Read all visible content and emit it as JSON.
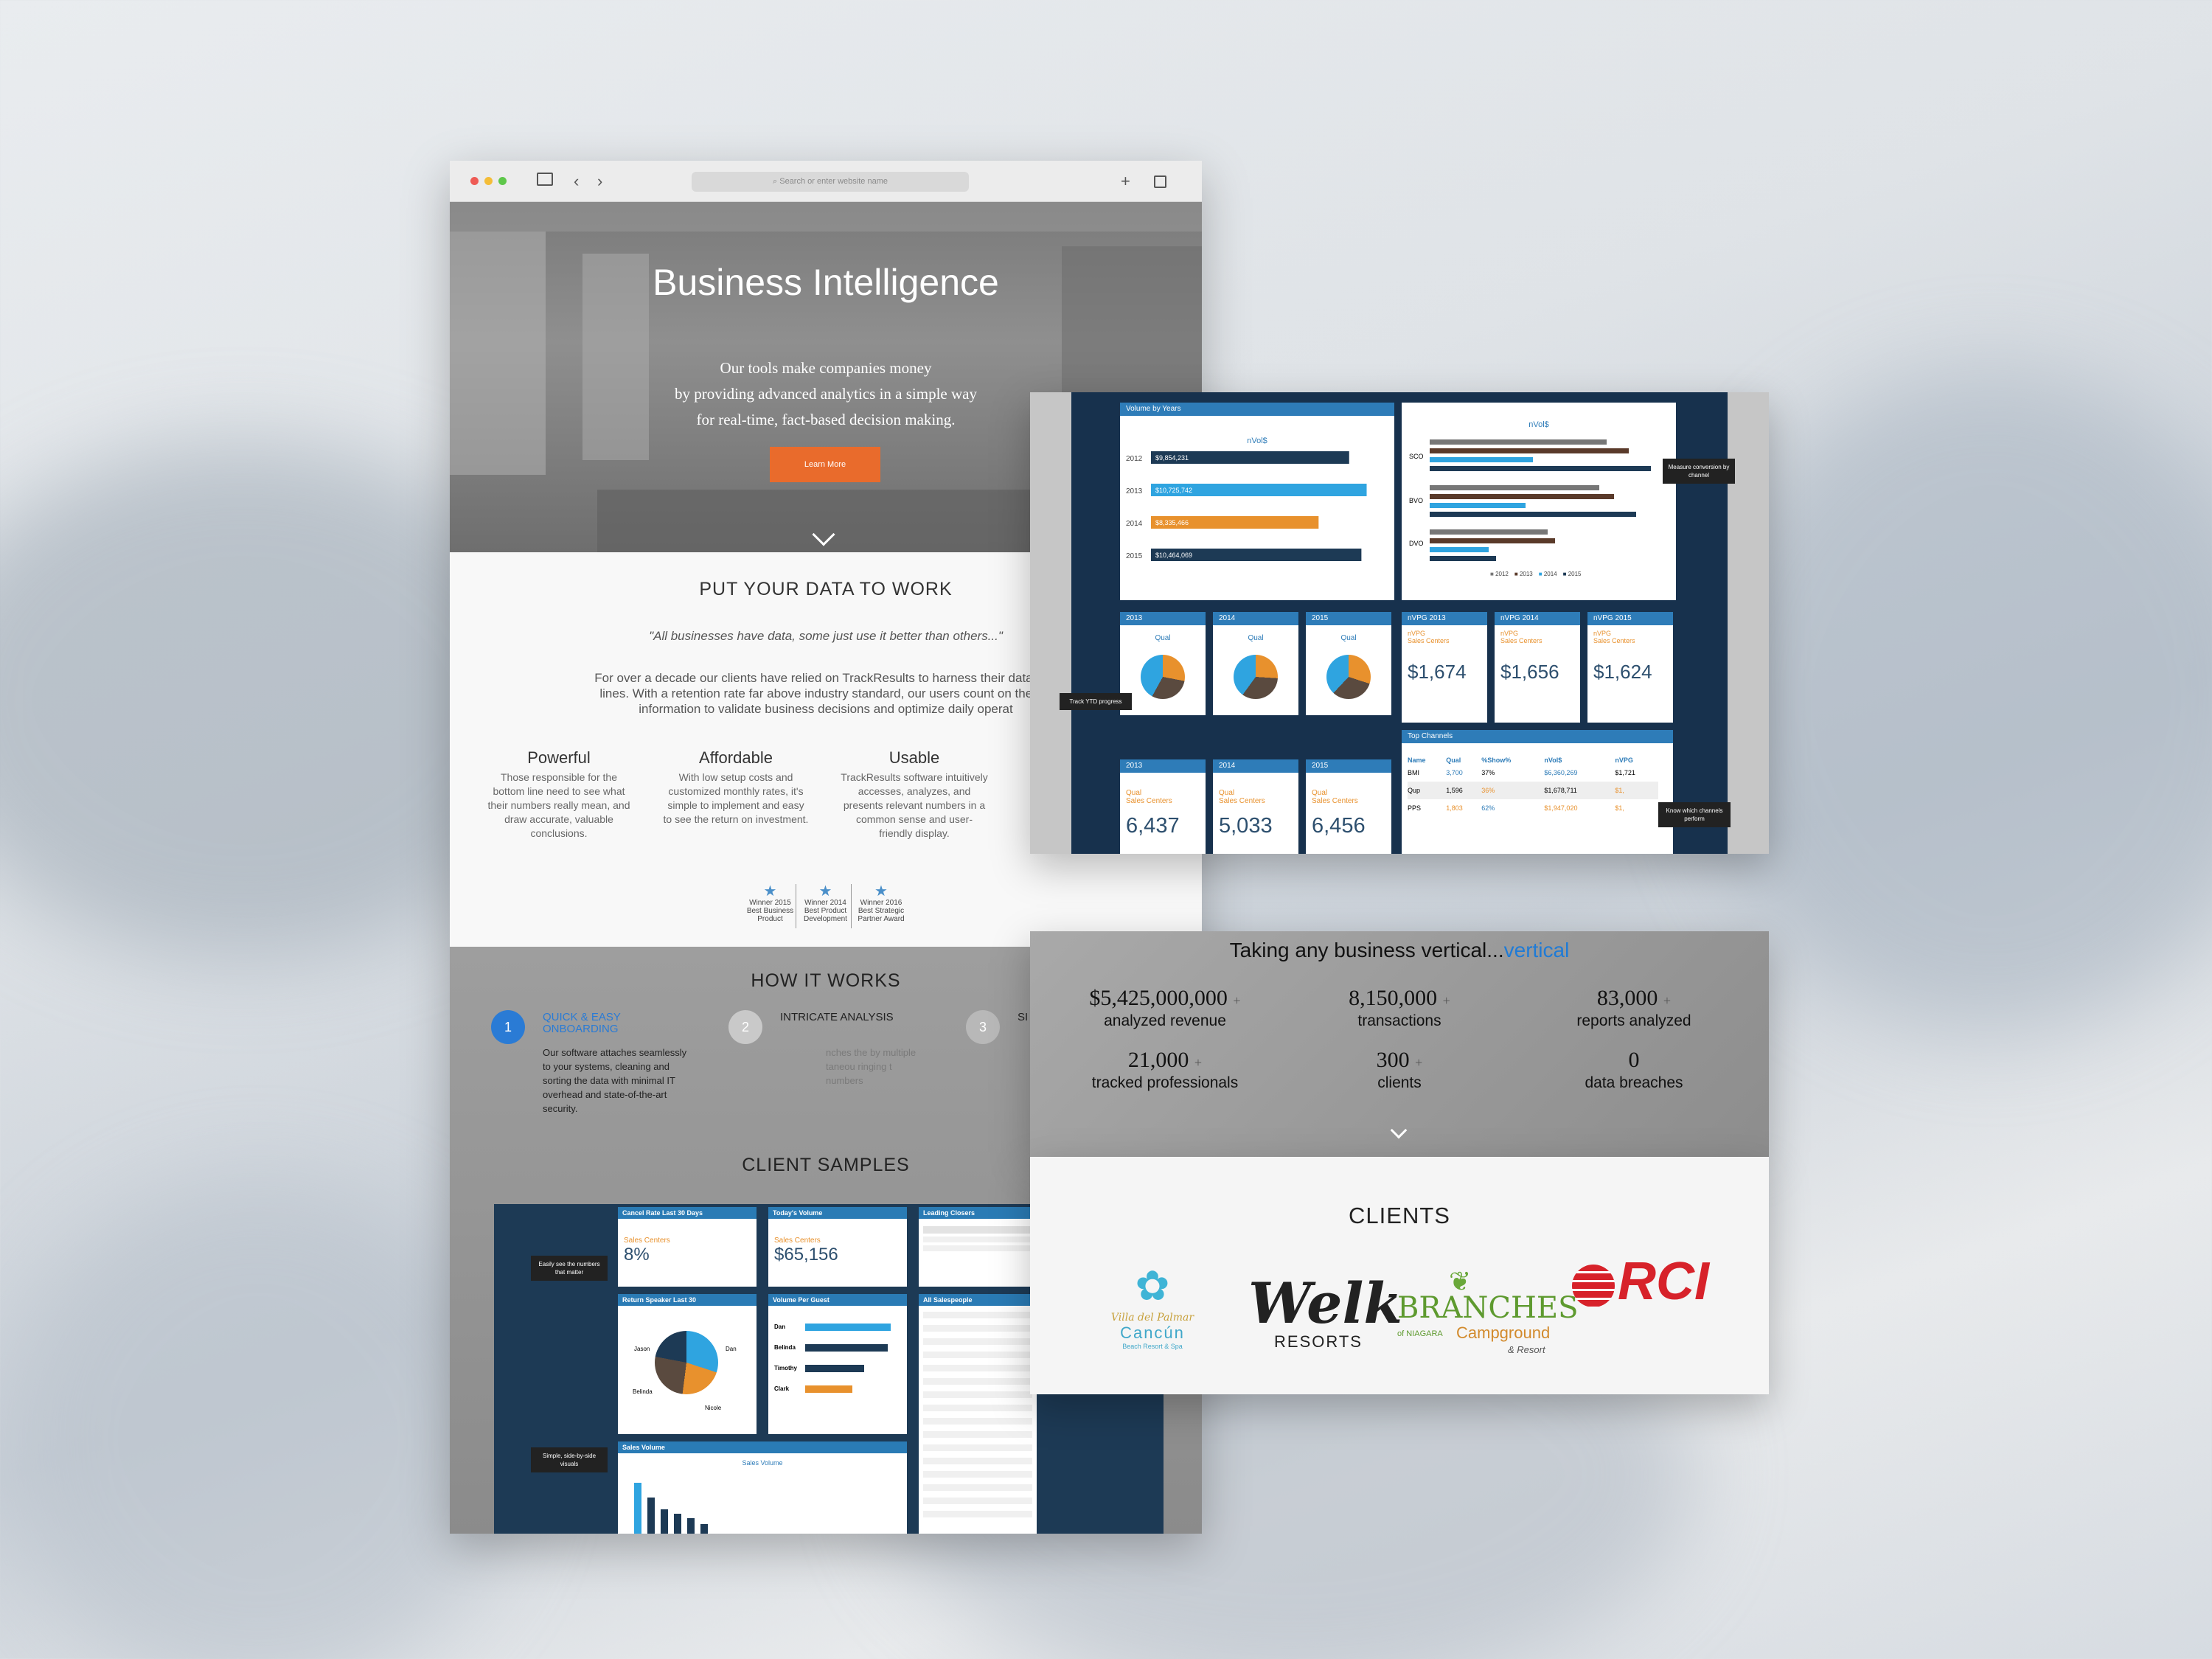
{
  "browser": {
    "url_placeholder": "Search or enter website name",
    "hero": {
      "title": "Business Intelligence",
      "text_lines": [
        "Our tools make companies money",
        "by providing advanced analytics in a simple way",
        "for real-time, fact-based decision making."
      ],
      "button": "Learn More"
    },
    "data_section": {
      "title": "PUT YOUR DATA TO WORK",
      "quote": "\"All businesses have data, some just use it better than others...\"",
      "paragraph_lines": [
        "For over a decade our clients have relied on TrackResults to harness their data and",
        "lines. With a retention rate far above industry standard, our users count on the cle",
        "information to validate business decisions and optimize daily operat"
      ],
      "features": [
        {
          "title": "Powerful",
          "text": "Those responsible for the bottom line need to see what their numbers really mean, and draw accurate, valuable conclusions."
        },
        {
          "title": "Affordable",
          "text": "With low setup costs and customized monthly rates, it's simple to implement and easy to see the return on investment."
        },
        {
          "title": "Usable",
          "text": "TrackResults software intuitively accesses, analyzes, and presents relevant numbers in a common sense and user-friendly display."
        }
      ],
      "awards": [
        {
          "text": "Winner 2015 Best Business Product"
        },
        {
          "text": "Winner 2014 Best Product Development"
        },
        {
          "text": "Winner 2016 Best Strategic Partner Award"
        }
      ]
    },
    "how": {
      "title": "HOW IT WORKS",
      "steps": [
        {
          "num": "1",
          "title": "QUICK & EASY ONBOARDING",
          "text": "Our software attaches seamlessly to your systems, cleaning and sorting the data with minimal IT overhead and state-of-the-art security."
        },
        {
          "num": "2",
          "title": "INTRICATE ANALYSIS",
          "text": "nches the by multiple taneou ringing t numbers"
        },
        {
          "num": "3",
          "title": "SI",
          "text": ""
        }
      ],
      "samples_title": "CLIENT SAMPLES",
      "sample_cards": {
        "cancel_title": "Cancel Rate Last 30 Days",
        "cancel_sub": "Sales Centers",
        "cancel_value": "8%",
        "today_title": "Today's Volume",
        "today_sub": "Sales Centers",
        "today_value": "$65,156",
        "leading_title": "Leading Closers",
        "return_title": "Return Speaker Last 30",
        "volume_agent_title": "Volume Per Guest",
        "all_sales_title": "All Salespeople",
        "sales_volume_title": "Sales Volume",
        "sales_volume_chart": "Sales Volume",
        "agent_names": [
          "Dan",
          "Belinda",
          "Timothy",
          "Clark"
        ],
        "pie_labels": [
          "Dan",
          "Jason",
          "Nicole",
          "Belinda"
        ]
      },
      "tips": [
        "Easily see the numbers that matter",
        "Simple, side-by-side visuals"
      ]
    }
  },
  "dashboard": {
    "volume_title": "Volume by Years",
    "volume_chart_title": "nVol$",
    "volume_chart2_title": "nVol$",
    "volume_rows": [
      {
        "year": "2012",
        "value": "$9,854,231"
      },
      {
        "year": "2013",
        "value": "$10,725,742"
      },
      {
        "year": "2014",
        "value": "$8,335,466"
      },
      {
        "year": "2015",
        "value": "$10,464,069"
      }
    ],
    "legend": [
      "2012",
      "2013",
      "2014",
      "2015"
    ],
    "channel_labels": [
      "SCO",
      "BVO",
      "DVO"
    ],
    "pie_cards": [
      {
        "year": "2013",
        "label": "Qual"
      },
      {
        "year": "2014",
        "label": "Qual"
      },
      {
        "year": "2015",
        "label": "Qual"
      }
    ],
    "nvpg_cards": [
      {
        "title": "nVPG 2013",
        "sub1": "nVPG",
        "sub2": "Sales Centers",
        "value": "$1,674"
      },
      {
        "title": "nVPG 2014",
        "sub1": "nVPG",
        "sub2": "Sales Centers",
        "value": "$1,656"
      },
      {
        "title": "nVPG 2015",
        "sub1": "nVPG",
        "sub2": "Sales Centers",
        "value": "$1,624"
      }
    ],
    "qual_cards": [
      {
        "year": "2013",
        "sub1": "Qual",
        "sub2": "Sales Centers",
        "value": "6,437"
      },
      {
        "year": "2014",
        "sub1": "Qual",
        "sub2": "Sales Centers",
        "value": "5,033"
      },
      {
        "year": "2015",
        "sub1": "Qual",
        "sub2": "Sales Centers",
        "value": "6,456"
      }
    ],
    "top_channels": {
      "title": "Top Channels",
      "headers": [
        "Name",
        "Qual",
        "%Show%",
        "nVol$",
        "nVPG"
      ],
      "rows": [
        [
          "BMI",
          "3,700",
          "37%",
          "$6,360,269",
          "$1,721"
        ],
        [
          "Qup",
          "1,596",
          "36%",
          "$1,678,711",
          "$1,"
        ],
        [
          "PPS",
          "1,803",
          "62%",
          "$1,947,020",
          "$1,"
        ]
      ]
    },
    "tips": [
      "Measure conversion by channel",
      "Track YTD progress",
      "Know which channels perform"
    ]
  },
  "stats": {
    "heading": "Taking any business vertical...",
    "heading_accent": "vertical",
    "items": [
      {
        "num": "$5,425,000,000",
        "label": "analyzed revenue"
      },
      {
        "num": "8,150,000",
        "label": "transactions"
      },
      {
        "num": "83,000",
        "label": "reports analyzed"
      },
      {
        "num": "21,000",
        "label": "tracked professionals"
      },
      {
        "num": "300",
        "label": "clients"
      },
      {
        "num": "0",
        "label": "data breaches"
      }
    ],
    "plus": "+"
  },
  "clients": {
    "title": "CLIENTS",
    "logos": {
      "villa_script": "Villa del Palmar",
      "villa_name": "Cancún",
      "villa_sub": "Beach Resort & Spa",
      "welk_script": "Welk",
      "welk_name": "RESORTS",
      "branches_name": "BRANCHES",
      "branches_of": "of NIAGARA",
      "branches_camp": "Campground",
      "branches_resort": "& Resort",
      "rci": "RCI"
    }
  },
  "colors": {
    "accent": "#e96b2c",
    "blue": "#2e7cb8",
    "navy": "#17314d",
    "orange": "#e8912d",
    "link": "#1f7bd6"
  }
}
